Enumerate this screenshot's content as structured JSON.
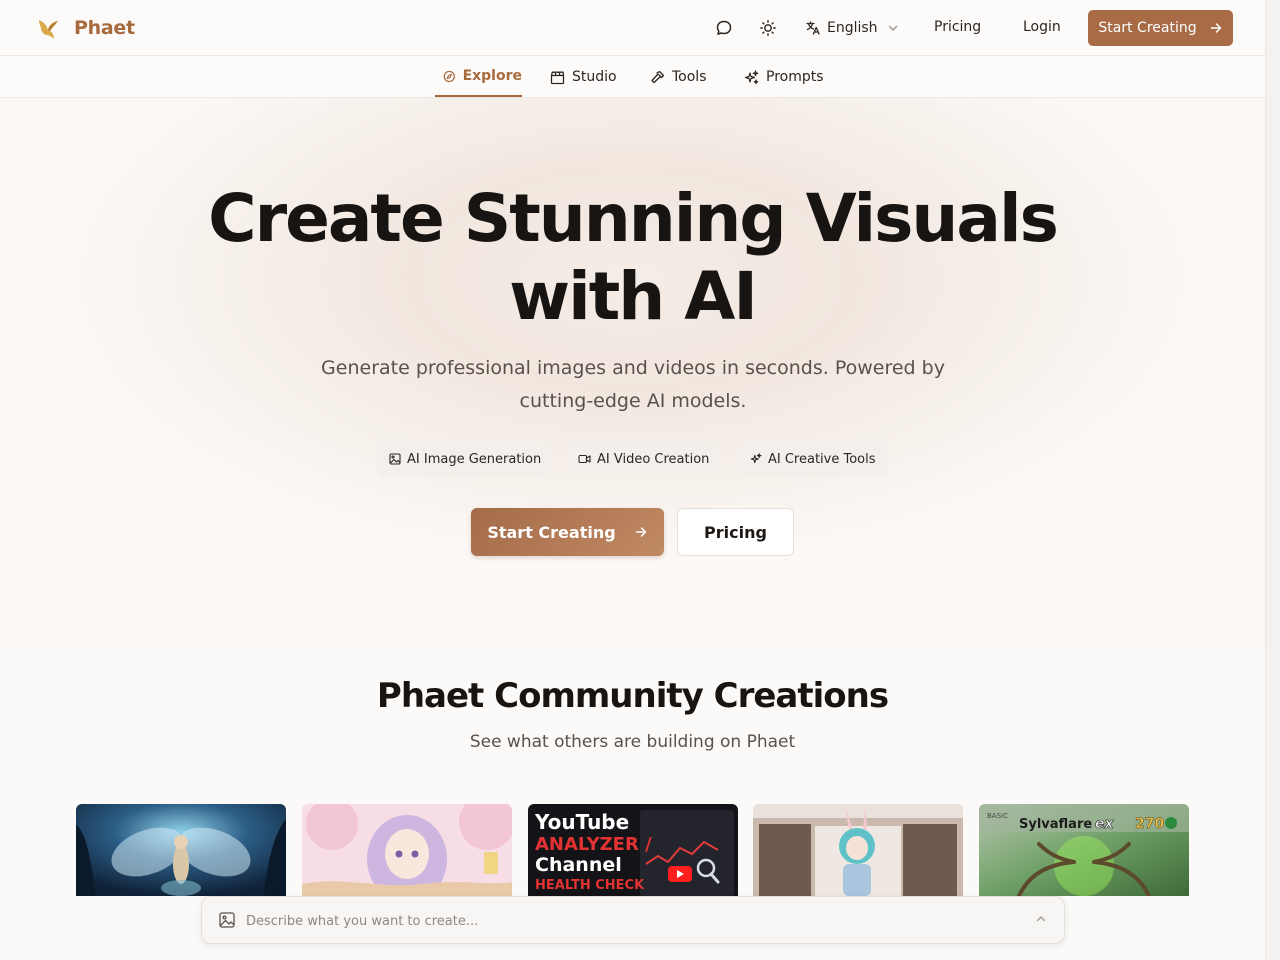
{
  "brand": {
    "name": "Phaet"
  },
  "header": {
    "language": "English",
    "pricing": "Pricing",
    "login": "Login",
    "cta": "Start Creating",
    "icons": [
      "chat-bubble-icon",
      "sun-icon",
      "translate-icon",
      "chevron-down-icon",
      "arrow-right-icon"
    ]
  },
  "nav": {
    "tabs": [
      {
        "label": "Explore",
        "icon": "compass-icon",
        "active": true
      },
      {
        "label": "Studio",
        "icon": "clapperboard-icon",
        "active": false
      },
      {
        "label": "Tools",
        "icon": "hammer-icon",
        "active": false
      },
      {
        "label": "Prompts",
        "icon": "sparkles-icon",
        "active": false
      }
    ]
  },
  "hero": {
    "title_line1": "Create Stunning Visuals",
    "title_line2": "with AI",
    "subtitle": "Generate professional images and videos in seconds. Powered by cutting-edge AI models.",
    "chips": [
      {
        "label": "AI Image Generation",
        "icon": "image-icon"
      },
      {
        "label": "AI Video Creation",
        "icon": "video-icon"
      },
      {
        "label": "AI Creative Tools",
        "icon": "sparkles-icon"
      }
    ],
    "cta": "Start Creating",
    "pricing": "Pricing"
  },
  "community": {
    "title": "Phaet Community Creations",
    "subtitle": "See what others are building on Phaet",
    "cards": [
      {
        "name": "fairy-forest"
      },
      {
        "name": "anime-girl-cherry-blossom"
      },
      {
        "name": "youtube-analyzer",
        "text_1": "YouTube",
        "text_2": "ANALYZER /",
        "text_3": "Channel",
        "text_4": "HEALTH CHECK"
      },
      {
        "name": "bunny-girl-closet"
      },
      {
        "name": "sylvaflare-card",
        "card_name": "Sylvaflare",
        "card_tag": "ex",
        "card_hp": "270",
        "card_stage": "BASIC"
      }
    ]
  },
  "prompt": {
    "placeholder": "Describe what you want to create..."
  },
  "colors": {
    "accent": "#a8693d",
    "cta": "#a86b45",
    "text": "#1b1613",
    "muted": "#5b514b"
  }
}
